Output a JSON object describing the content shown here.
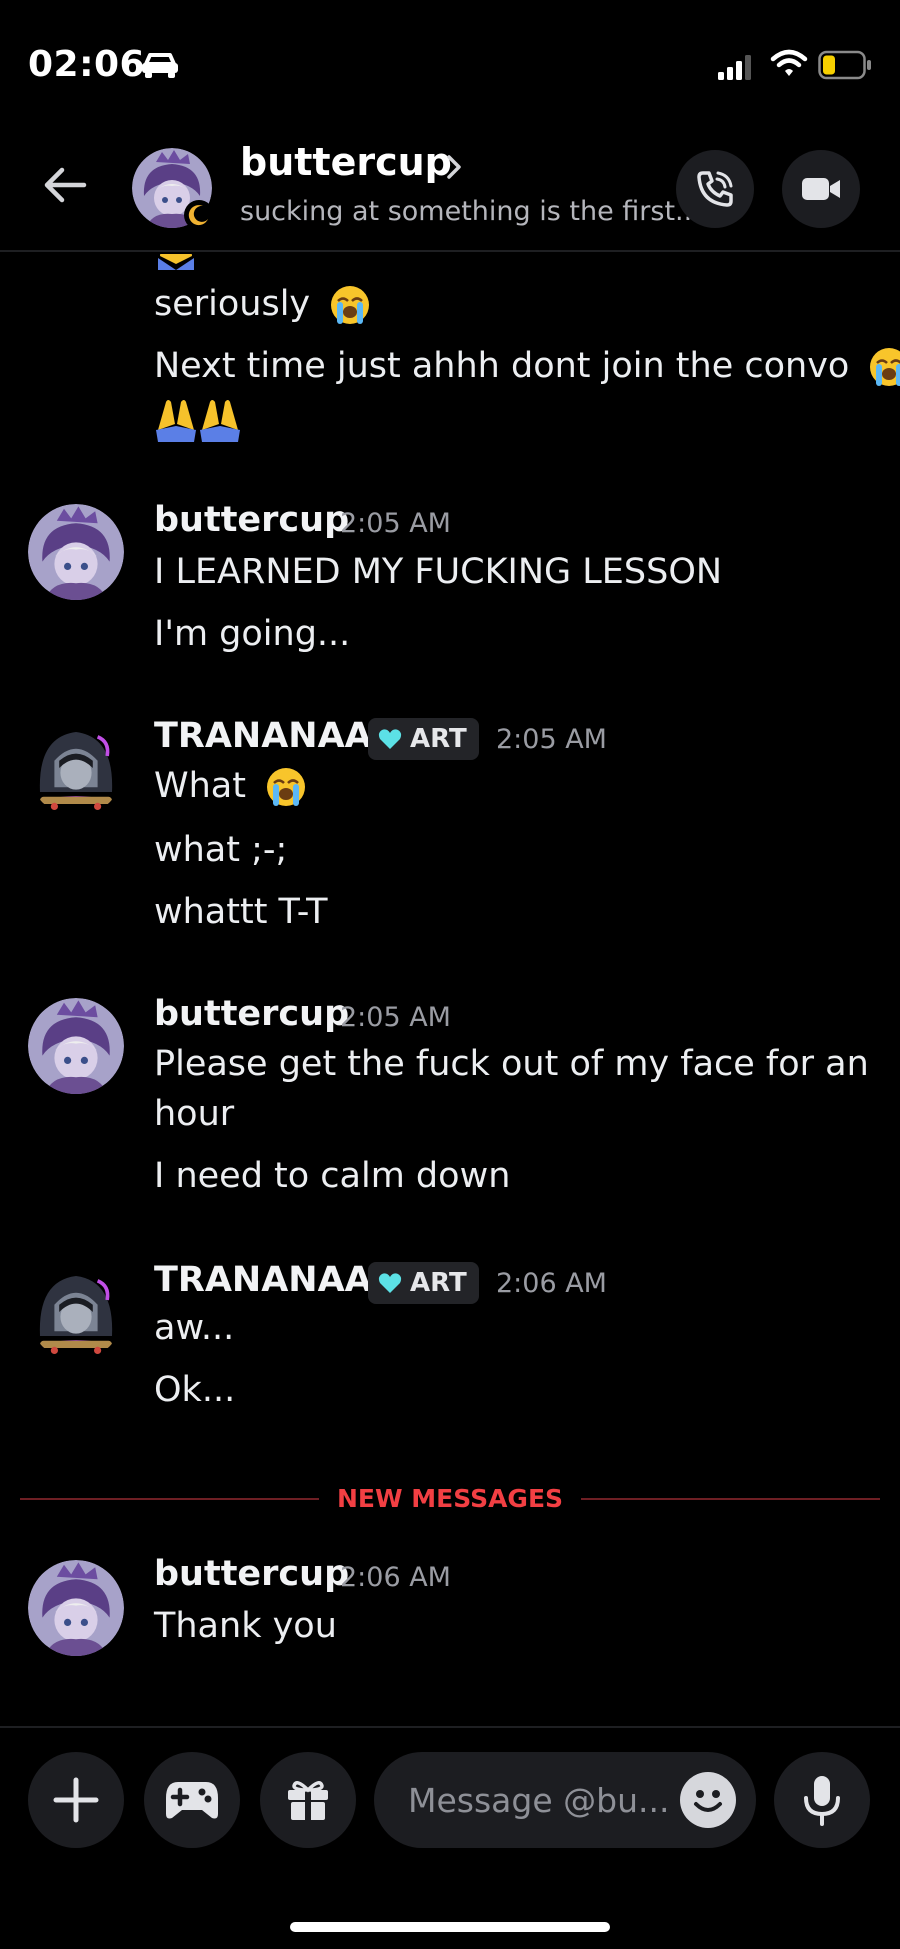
{
  "status_bar": {
    "time": "02:06"
  },
  "header": {
    "name": "buttercup",
    "status": "sucking at something is the first..."
  },
  "messages": {
    "prev_line_1": "seriously",
    "prev_line_2": "Next time just ahhh dont join the convo",
    "group1": {
      "author": "buttercup",
      "time": "2:05 AM",
      "lines": [
        "I LEARNED MY FUCKING LESSON",
        "I'm going..."
      ]
    },
    "group2": {
      "author": "TRANANAA",
      "tag": "ART",
      "time": "2:05 AM",
      "lines": [
        "What",
        "what ;-;",
        "whattt T-T"
      ]
    },
    "group3": {
      "author": "buttercup",
      "time": "2:05 AM",
      "lines": [
        "Please get the fuck out of my face for an",
        "hour",
        "I need to calm down"
      ]
    },
    "group4": {
      "author": "TRANANAA",
      "tag": "ART",
      "time": "2:06 AM",
      "lines": [
        "aw...",
        "Ok..."
      ]
    },
    "new_messages_label": "NEW MESSAGES",
    "group5": {
      "author": "buttercup",
      "time": "2:06 AM",
      "lines": [
        "Thank you"
      ]
    }
  },
  "composer": {
    "placeholder": "Message @bu..."
  },
  "colors": {
    "background": "#000000",
    "new_messages": "#f23f43",
    "tag_heart": "#5ce1e6"
  },
  "icons": [
    "car-icon",
    "signal-icon",
    "wifi-icon",
    "battery-icon",
    "back-arrow-icon",
    "moon-icon",
    "chevron-right-icon",
    "phone-call-icon",
    "video-camera-icon",
    "loudly-crying-emoji",
    "folded-hands-emoji",
    "heart-icon",
    "plus-icon",
    "gamepad-icon",
    "gift-icon",
    "emoji-icon",
    "microphone-icon"
  ]
}
